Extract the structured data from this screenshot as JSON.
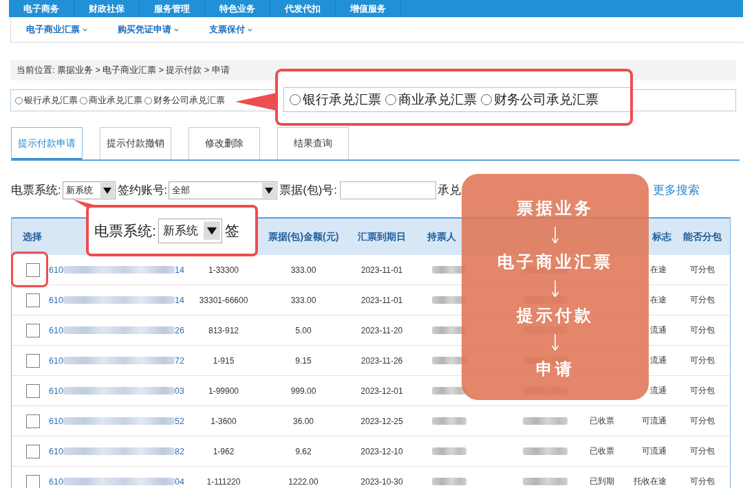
{
  "top_nav": [
    "电子商务",
    "财政社保",
    "服务管理",
    "特色业务",
    "代发代扣",
    "增值服务"
  ],
  "sub_nav": [
    "电子商业汇票",
    "购买凭证申请",
    "支票保付"
  ],
  "breadcrumb": "当前位置: 票据业务 > 电子商业汇票 > 提示付款 > 申请",
  "bill_types": [
    {
      "label": "银行承兑汇票",
      "selected": false
    },
    {
      "label": "商业承兑汇票",
      "selected": false
    },
    {
      "label": "财务公司承兑汇票",
      "selected": false
    }
  ],
  "tabs": [
    {
      "label": "提示付款申请",
      "selected": true
    },
    {
      "label": "提示付款撤销",
      "selected": false
    },
    {
      "label": "修改删除",
      "selected": false
    },
    {
      "label": "结果查询",
      "selected": false
    }
  ],
  "filters": [
    {
      "kind": "select",
      "label": "电票系统:",
      "value": "新系统"
    },
    {
      "kind": "select",
      "label": "签约账号:",
      "value": "全部"
    },
    {
      "kind": "input",
      "label": "票据(包)号:"
    },
    {
      "kind": "text",
      "label": "承兑"
    }
  ],
  "more_search_link": "更多搜索",
  "table": {
    "header": {
      "select": "选择",
      "amount": "票据(包)金额(元)",
      "due_date": "汇票到期日",
      "holder": "持票人",
      "circulation": "标志",
      "split": "能否分包"
    },
    "rows": [
      {
        "checked": false,
        "bill_no_start": "610",
        "bill_no_end": "14",
        "range": "1-33300",
        "amount": "333.00",
        "due_date": "2023-11-01",
        "circulation": "在途",
        "split": "可分包"
      },
      {
        "checked": false,
        "bill_no_start": "610",
        "bill_no_end": "14",
        "range": "33301-66600",
        "amount": "333.00",
        "due_date": "2023-11-01",
        "circulation": "在途",
        "split": "可分包"
      },
      {
        "checked": false,
        "bill_no_start": "610",
        "bill_no_end": "26",
        "range": "813-912",
        "amount": "5.00",
        "due_date": "2023-11-20",
        "circulation": "流通",
        "split": "可分包"
      },
      {
        "checked": false,
        "bill_no_start": "610",
        "bill_no_end": "72",
        "range": "1-915",
        "amount": "9.15",
        "due_date": "2023-11-26",
        "circulation": "流通",
        "split": "可分包"
      },
      {
        "checked": false,
        "bill_no_start": "610",
        "bill_no_end": "03",
        "range": "1-99900",
        "amount": "999.00",
        "due_date": "2023-12-01",
        "circulation": "流通",
        "split": "可分包"
      },
      {
        "checked": false,
        "bill_no_start": "610",
        "bill_no_end": "52",
        "range": "1-3600",
        "amount": "36.00",
        "due_date": "2023-12-25",
        "status": "已收票",
        "circulation": "可流通",
        "split": "可分包"
      },
      {
        "checked": false,
        "bill_no_start": "610",
        "bill_no_end": "82",
        "range": "1-962",
        "amount": "9.62",
        "due_date": "2023-12-10",
        "status": "已收票",
        "circulation": "可流通",
        "split": "可分包"
      },
      {
        "checked": false,
        "bill_no_start": "610",
        "bill_no_end": "04",
        "range": "1-111220",
        "amount": "1222.00",
        "due_date": "2023-10-30",
        "status": "已到期",
        "circulation": "托收在途",
        "split": "可分包"
      }
    ]
  },
  "annotations": {
    "bill_type_zoom": [
      {
        "label": "银行承兑汇票",
        "selected": false
      },
      {
        "label": "商业承兑汇票",
        "selected": false
      },
      {
        "label": "财务公司承兑汇票",
        "selected": false
      }
    ],
    "filter_zoom": {
      "label": "电票系统:",
      "value": "新系统",
      "next_label": "签"
    },
    "flow": [
      "票据业务",
      "电子商业汇票",
      "提示付款",
      "申请"
    ]
  }
}
